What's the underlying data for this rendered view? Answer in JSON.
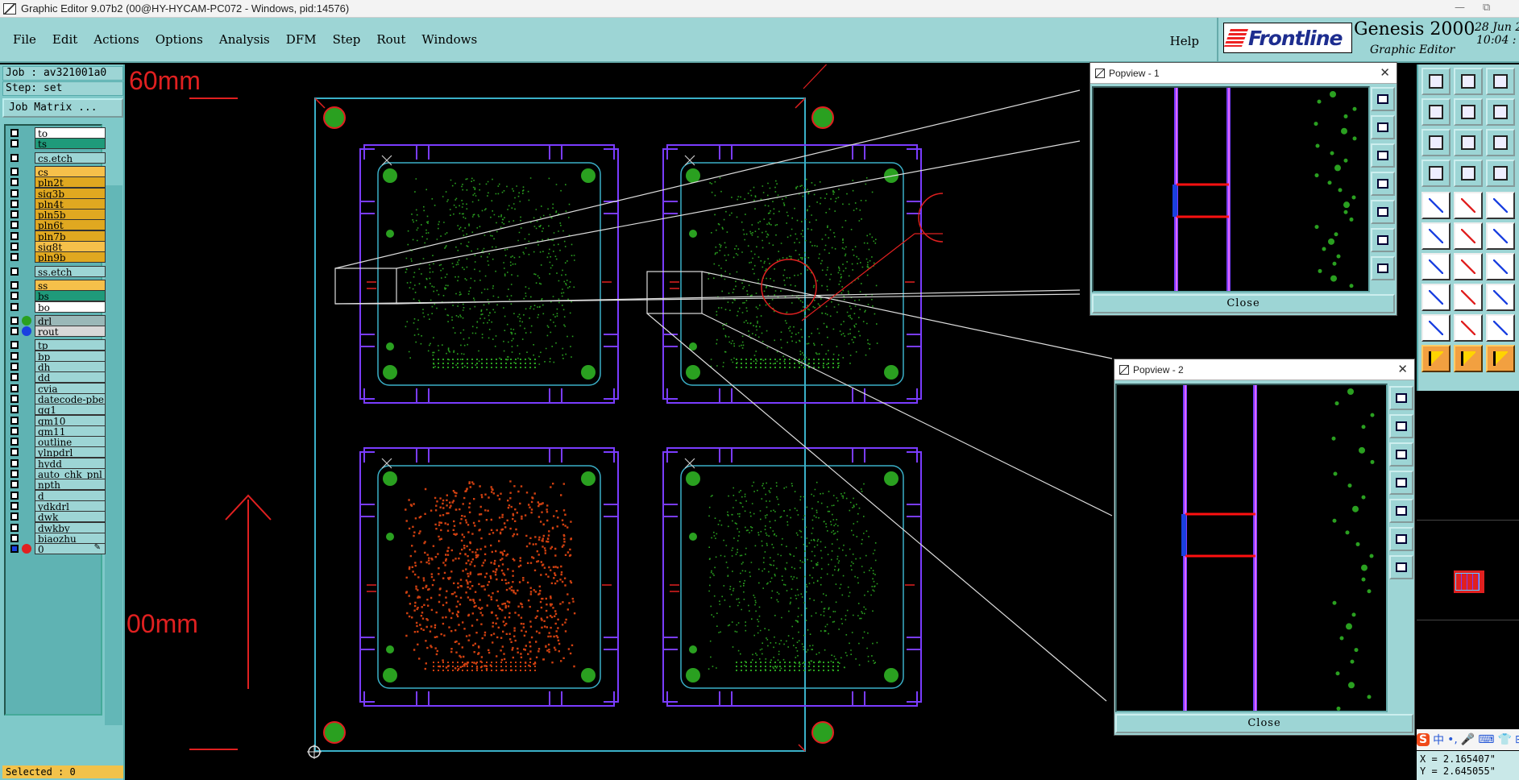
{
  "window": {
    "title": "Graphic Editor 9.07b2 (00@HY-HYCAM-PC072 - Windows, pid:14576)",
    "minimize": "—",
    "restore": "⧉"
  },
  "menu": {
    "items": [
      "File",
      "Edit",
      "Actions",
      "Options",
      "Analysis",
      "DFM",
      "Step",
      "Rout",
      "Windows"
    ],
    "help": "Help"
  },
  "brand": {
    "logo": "Frontline",
    "product": "Genesis 2000",
    "subtitle": "Graphic Editor",
    "date": "28 Jun 2",
    "time": "10:04 :"
  },
  "job": {
    "job_label": "Job : av321001a0",
    "step_label": "Step: set",
    "matrix_button": "Job Matrix ..."
  },
  "layers": [
    {
      "name": "to",
      "color": "#ffffff",
      "mark": ""
    },
    {
      "name": "ts",
      "color": "#1f9a7a",
      "mark": ""
    },
    {
      "name": "cs.etch",
      "color": "#9dd5d5",
      "mark": "",
      "gap": true
    },
    {
      "name": "cs",
      "color": "#f6c04a",
      "mark": "",
      "gap": true
    },
    {
      "name": "pln2t",
      "color": "#e0a820",
      "mark": ""
    },
    {
      "name": "sig3b",
      "color": "#e0a820",
      "mark": ""
    },
    {
      "name": "pln4t",
      "color": "#e0a820",
      "mark": ""
    },
    {
      "name": "pln5b",
      "color": "#e0a820",
      "mark": ""
    },
    {
      "name": "pln6t",
      "color": "#e0a820",
      "mark": ""
    },
    {
      "name": "pln7b",
      "color": "#e0a820",
      "mark": ""
    },
    {
      "name": "sig8t",
      "color": "#f6c04a",
      "mark": ""
    },
    {
      "name": "pln9b",
      "color": "#e0a820",
      "mark": ""
    },
    {
      "name": "ss.etch",
      "color": "#9dd5d5",
      "mark": "",
      "gap": true
    },
    {
      "name": "ss",
      "color": "#f6c04a",
      "mark": "",
      "gap": true
    },
    {
      "name": "bs",
      "color": "#1f9a7a",
      "mark": ""
    },
    {
      "name": "bo",
      "color": "#ffffff",
      "mark": ""
    },
    {
      "name": "drl",
      "color": "#9ab8b8",
      "mark": "#2aa020",
      "gap": true
    },
    {
      "name": "rout",
      "color": "#d8d8d8",
      "mark": "#1a40e0"
    },
    {
      "name": "tp",
      "color": "#9dd5d5",
      "mark": "",
      "gap": true
    },
    {
      "name": "bp",
      "color": "#9dd5d5",
      "mark": ""
    },
    {
      "name": "dh",
      "color": "#9dd5d5",
      "mark": ""
    },
    {
      "name": "dd",
      "color": "#9dd5d5",
      "mark": ""
    },
    {
      "name": "cvia",
      "color": "#9dd5d5",
      "mark": ""
    },
    {
      "name": "datecode-pbe",
      "color": "#9dd5d5",
      "mark": ""
    },
    {
      "name": "gg1",
      "color": "#9dd5d5",
      "mark": ""
    },
    {
      "name": "gm10",
      "color": "#9dd5d5",
      "mark": ""
    },
    {
      "name": "gm11",
      "color": "#9dd5d5",
      "mark": ""
    },
    {
      "name": "outline",
      "color": "#9dd5d5",
      "mark": ""
    },
    {
      "name": "ylnpdrl",
      "color": "#9dd5d5",
      "mark": ""
    },
    {
      "name": "hydd",
      "color": "#9dd5d5",
      "mark": ""
    },
    {
      "name": "auto_chk_pnl",
      "color": "#9dd5d5",
      "mark": ""
    },
    {
      "name": "npth",
      "color": "#9dd5d5",
      "mark": ""
    },
    {
      "name": "d",
      "color": "#9dd5d5",
      "mark": ""
    },
    {
      "name": "ydkdrl",
      "color": "#9dd5d5",
      "mark": ""
    },
    {
      "name": "dwk",
      "color": "#9dd5d5",
      "mark": ""
    },
    {
      "name": "dwkby",
      "color": "#9dd5d5",
      "mark": ""
    },
    {
      "name": "biaozhu",
      "color": "#9dd5d5",
      "mark": ""
    },
    {
      "name": "0",
      "color": "#9dd5d5",
      "mark": "#e02020",
      "extra": "✎"
    }
  ],
  "status": {
    "selected": "Selected : 0",
    "x": "X = 2.165407\"",
    "y": "Y = 2.645055\""
  },
  "canvas": {
    "label_top": "60mm",
    "label_bottom": "00mm"
  },
  "popview1": {
    "title": "Popview - 1",
    "close": "Close"
  },
  "popview2": {
    "title": "Popview - 2",
    "close": "Close"
  },
  "ime": [
    "S",
    "中",
    "•,",
    "🎤",
    "⌨",
    "👕",
    "⊞"
  ],
  "colors": {
    "menu_bg": "#9dd5d5",
    "profile": "#3ab0c8",
    "panel_outline": "#7a3cff",
    "pad_green": "#2aa020",
    "route_red": "#e02020",
    "top_component": "#d04010"
  }
}
